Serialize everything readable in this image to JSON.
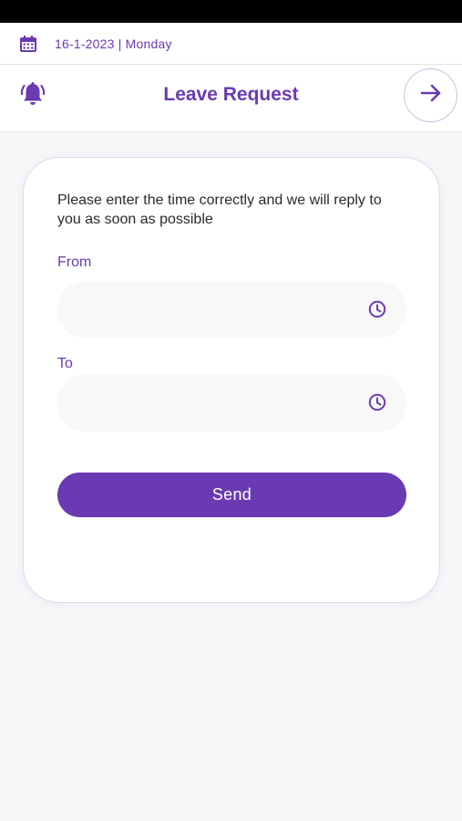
{
  "date_bar": {
    "calendar_icon": "calendar-icon",
    "date_text": "16-1-2023 | Monday"
  },
  "header": {
    "title": "Leave Request",
    "bell_icon": "bell-icon",
    "next_icon": "arrow-right-icon"
  },
  "form": {
    "instructions": "Please enter the time correctly and we will reply to you as soon as possible",
    "from_label": "From",
    "from_value": "",
    "to_label": "To",
    "to_value": "",
    "clock_icon": "clock-icon",
    "send_label": "Send"
  },
  "colors": {
    "accent": "#6a3ab2",
    "background": "#f7f7f8",
    "field_background": "#f8f8f8",
    "status_bar": "#000000"
  }
}
